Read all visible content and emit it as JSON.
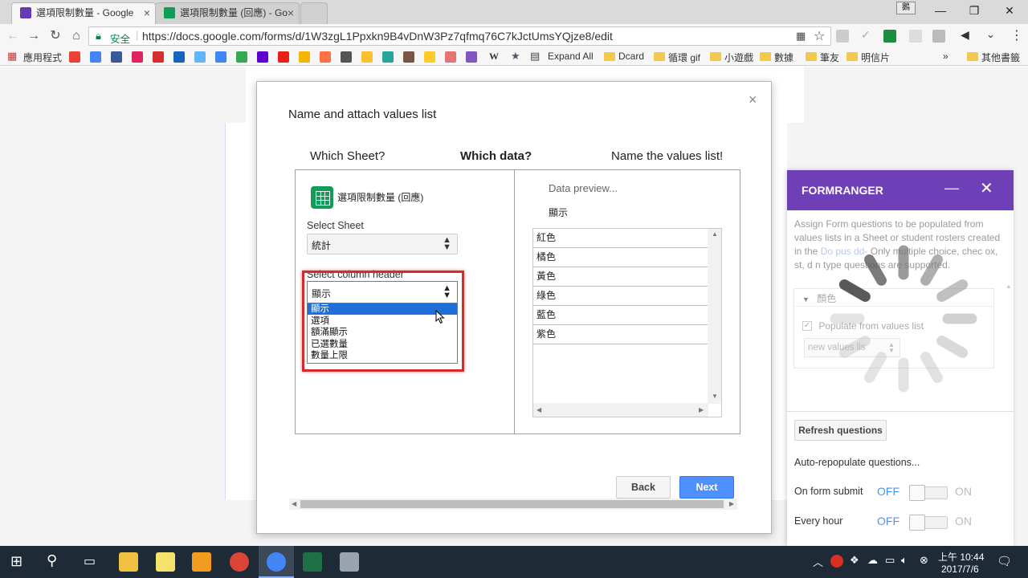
{
  "browser": {
    "tabs": [
      {
        "title": "選項限制數量 - Google ",
        "active": true
      },
      {
        "title": "選項限制數量 (回應) - Go",
        "active": false
      }
    ],
    "profile_label": "鵝",
    "security_label": "安全",
    "url": "https://docs.google.com/forms/d/1W3zgL1Ppxkn9B4vDnW3Pz7qfmq76C7kJctUmsYQjze8/edit",
    "bookmarks": {
      "apps_label": "應用程式",
      "expand_all": "Expand All",
      "dcard": "Dcard",
      "gif": "循環 gif",
      "game": "小遊戲",
      "data": "數據",
      "friends": "筆友",
      "postcard": "明信片",
      "more": "»",
      "other": "其他書籤"
    }
  },
  "dialog": {
    "title": "Name and attach values list",
    "close": "×",
    "steps": [
      "Which Sheet?",
      "Which data?",
      "Name the values list!"
    ],
    "sheet_name": "選項限制數量 (回應)",
    "select_sheet_label": "Select Sheet",
    "select_sheet_value": "統計",
    "select_column_label": "Select column header",
    "select_column_value": "顯示",
    "column_options": [
      "顯示",
      "選項",
      "額滿顯示",
      "已選數量",
      "數量上限"
    ],
    "preview_label": "Data preview...",
    "preview_header": "顯示",
    "preview_rows": [
      "紅色",
      "橘色",
      "黃色",
      "綠色",
      "藍色",
      "紫色"
    ],
    "back_label": "Back",
    "next_label": "Next"
  },
  "sidebar": {
    "title": "FORMRANGER",
    "minimize": "—",
    "close": "✕",
    "desc_1": "Assign Form questions to be populated from values lists in a Sheet or student rosters created in the ",
    "desc_link": "Do  pus  dd-",
    "desc_2": " Only multiple choice, chec  ox,   st,   d  n type questions are supported.",
    "question": "顏色",
    "populate_label": "Populate from values list",
    "values_select": "new values lis",
    "refresh_label": "Refresh questions",
    "auto_label": "Auto-repopulate questions...",
    "on_submit_label": "On form submit",
    "every_hour_label": "Every hour",
    "off": "OFF",
    "on": "ON"
  },
  "taskbar": {
    "time": "上午 10:44",
    "date": "2017/7/6"
  }
}
